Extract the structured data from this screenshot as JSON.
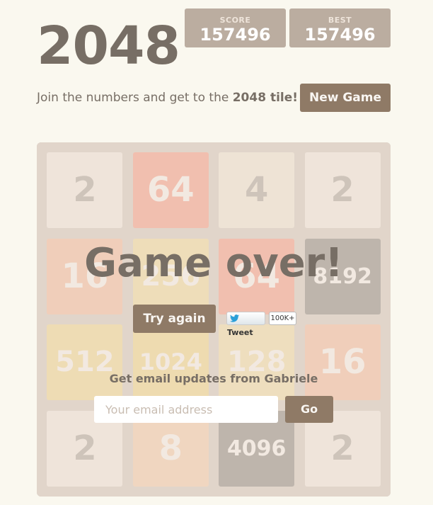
{
  "header": {
    "title": "2048",
    "score_label": "SCORE",
    "score_value": "157496",
    "best_label": "BEST",
    "best_value": "157496"
  },
  "intro": {
    "text_before": "Join the numbers and get to the ",
    "text_bold": "2048 tile!"
  },
  "new_game_label": "New Game",
  "board": {
    "rows": [
      [
        "2",
        "64",
        "4",
        "2"
      ],
      [
        "16",
        "256",
        "64",
        "8192"
      ],
      [
        "512",
        "1024",
        "128",
        "16"
      ],
      [
        "2",
        "8",
        "4096",
        "2"
      ]
    ]
  },
  "game_over": {
    "message": "Game over!",
    "try_again_label": "Try again",
    "tweet_label": "Tweet",
    "tweet_count": "100K+"
  },
  "email": {
    "heading": "Get email updates from Gabriele",
    "placeholder": "Your email address",
    "go_label": "Go"
  },
  "colors": {
    "background": "#faf8ef",
    "board": "#bbada0",
    "button": "#8f7a66",
    "text": "#776e65"
  }
}
